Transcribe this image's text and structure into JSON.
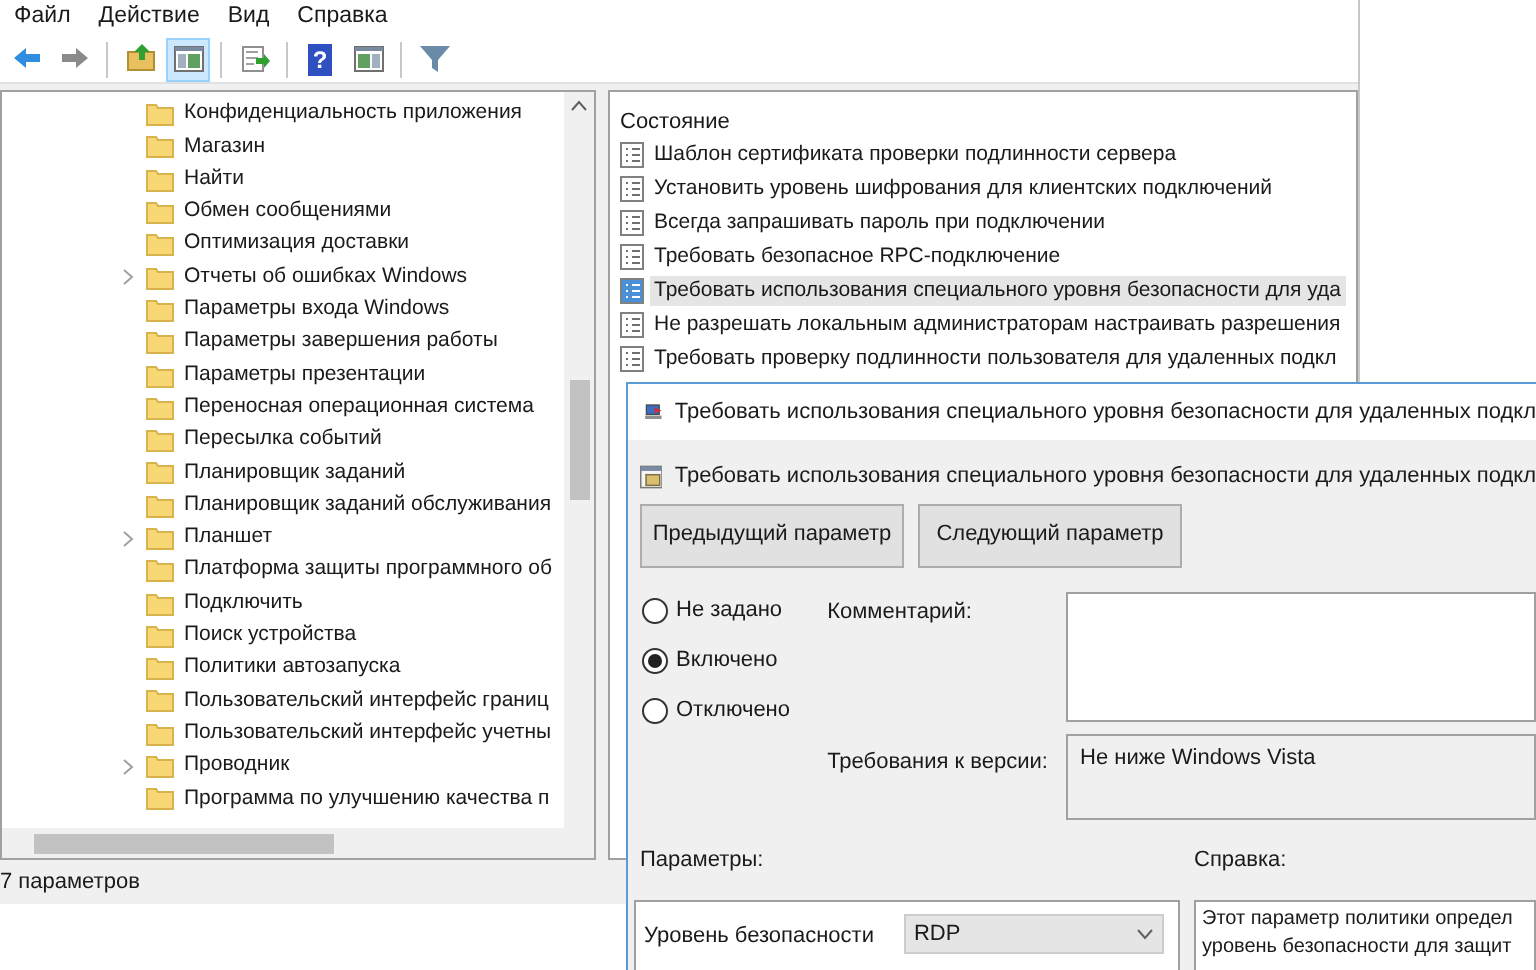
{
  "menu_bar": [
    "Файл",
    "Действие",
    "Вид",
    "Справка"
  ],
  "toolbar": [
    [
      {
        "kind": "back",
        "selected": false
      },
      {
        "kind": "forward",
        "selected": false
      }
    ],
    [
      {
        "kind": "up",
        "selected": false
      },
      {
        "kind": "tree",
        "selected": true
      }
    ],
    [
      {
        "kind": "export",
        "selected": false
      }
    ],
    [
      {
        "kind": "help",
        "selected": false,
        "glyph": "?"
      },
      {
        "kind": "panel",
        "selected": false
      }
    ],
    [
      {
        "kind": "filter",
        "selected": false
      }
    ]
  ],
  "tree": {
    "items": [
      {
        "label": "Конфиденциальность приложения",
        "expandable": false
      },
      {
        "label": "Магазин",
        "expandable": false
      },
      {
        "label": "Найти",
        "expandable": false
      },
      {
        "label": "Обмен сообщениями",
        "expandable": false
      },
      {
        "label": "Оптимизация доставки",
        "expandable": false
      },
      {
        "label": "Отчеты об ошибках Windows",
        "expandable": true
      },
      {
        "label": "Параметры входа Windows",
        "expandable": false
      },
      {
        "label": "Параметры завершения работы",
        "expandable": false
      },
      {
        "label": "Параметры презентации",
        "expandable": false
      },
      {
        "label": "Переносная операционная система",
        "expandable": false
      },
      {
        "label": "Пересылка событий",
        "expandable": false
      },
      {
        "label": "Планировщик заданий",
        "expandable": false
      },
      {
        "label": "Планировщик заданий обслуживания",
        "expandable": false
      },
      {
        "label": "Планшет",
        "expandable": true
      },
      {
        "label": "Платформа защиты программного об",
        "expandable": false
      },
      {
        "label": "Подключить",
        "expandable": false
      },
      {
        "label": "Поиск устройства",
        "expandable": false
      },
      {
        "label": "Политики автозапуска",
        "expandable": false
      },
      {
        "label": "Пользовательский интерфейс границ",
        "expandable": false
      },
      {
        "label": "Пользовательский интерфейс учетны",
        "expandable": false
      },
      {
        "label": "Проводник",
        "expandable": true
      },
      {
        "label": "Программа по улучшению качества п",
        "expandable": false
      }
    ]
  },
  "status_bar": "7 параметров",
  "list": {
    "header": "Состояние",
    "items": [
      {
        "label": "Шаблон сертификата проверки подлинности сервера",
        "selected": false
      },
      {
        "label": "Установить уровень шифрования для клиентских подключений",
        "selected": false
      },
      {
        "label": "Всегда запрашивать пароль при подключении",
        "selected": false
      },
      {
        "label": "Требовать безопасное RPC-подключение",
        "selected": false
      },
      {
        "label": "Требовать использования специального уровня безопасности для уда",
        "selected": true
      },
      {
        "label": "Не разрешать локальным администраторам настраивать разрешения",
        "selected": false
      },
      {
        "label": "Требовать проверку подлинности пользователя для удаленных подкл",
        "selected": false
      }
    ]
  },
  "dialog": {
    "title": "Требовать использования специального уровня безопасности для удаленных подкл",
    "setting_title": "Требовать использования специального уровня безопасности для удаленных подкл",
    "buttons": [
      "Предыдущий параметр",
      "Следующий параметр"
    ],
    "radios": [
      {
        "label": "Не задано",
        "selected": false
      },
      {
        "label": "Включено",
        "selected": true
      },
      {
        "label": "Отключено",
        "selected": false
      }
    ],
    "comment_label": "Комментарий:",
    "version_label": "Требования к версии:",
    "version_value": "Не ниже Windows Vista",
    "options_label": "Параметры:",
    "help_label": "Справка:",
    "option": {
      "label": "Уровень безопасности",
      "value": "RDP"
    },
    "help_text": [
      "Этот параметр политики определ",
      "уровень безопасности для защит"
    ]
  }
}
